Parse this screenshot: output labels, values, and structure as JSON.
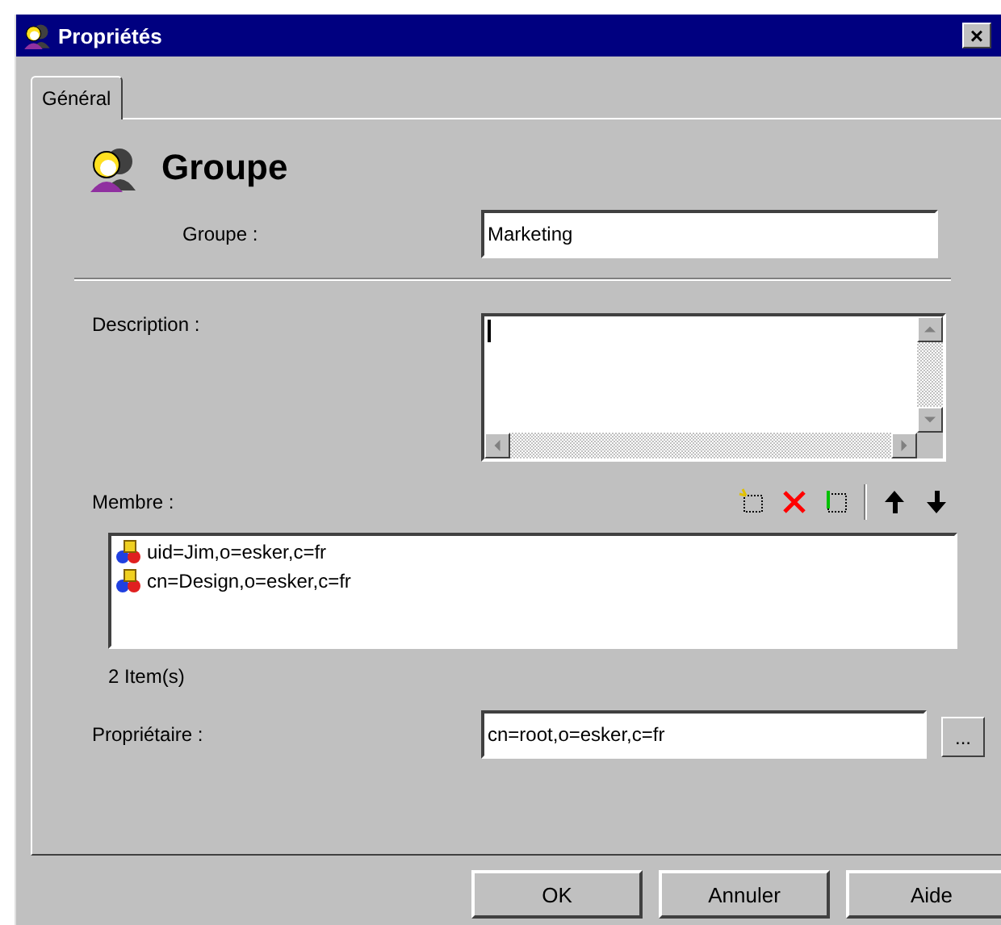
{
  "window": {
    "title": "Propriétés",
    "close": "×"
  },
  "tabs": [
    {
      "label": "Général",
      "selected": true
    }
  ],
  "header": {
    "title": "Groupe"
  },
  "group_field": {
    "label": "Groupe :",
    "value": "Marketing"
  },
  "description": {
    "label": "Description :"
  },
  "members": {
    "label": "Membre :",
    "items": [
      {
        "text": "uid=Jim,o=esker,c=fr"
      },
      {
        "text": "cn=Design,o=esker,c=fr"
      }
    ],
    "count": "2 Item(s)"
  },
  "owner": {
    "label": "Propriétaire :",
    "value": "cn=root,o=esker,c=fr",
    "browse": "..."
  },
  "buttons": [
    "OK",
    "Annuler",
    "Aide"
  ]
}
